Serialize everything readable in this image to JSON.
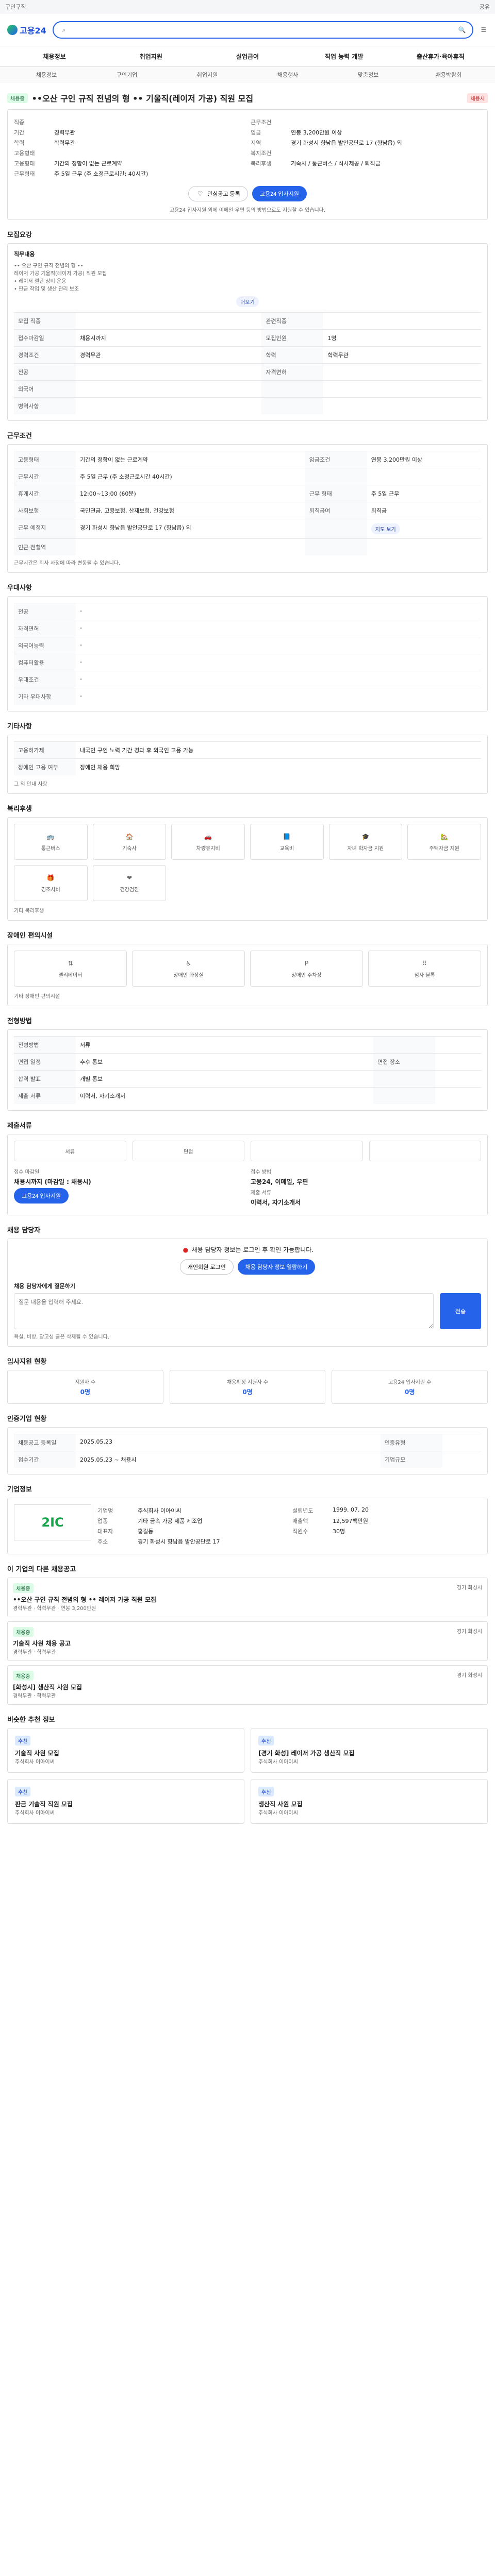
{
  "top": {
    "text": "구인구직",
    "right": "공유"
  },
  "header": {
    "logo": "고용24",
    "search_placeholder": "",
    "search_value": ""
  },
  "gnb": [
    "채용정보",
    "취업지원",
    "실업급여",
    "직업 능력 개발",
    "출산휴가·육아휴직"
  ],
  "subnav": [
    "채용정보",
    "구인기업",
    "취업지원",
    "채용행사",
    "맞춤정보",
    "채용박람회"
  ],
  "job": {
    "badge": "채용중",
    "title": "••오산 구인 규직 전념의 형 •• 기울직(레이저 가공) 직원 모집",
    "status_tag": "채용시",
    "left": [
      {
        "k": "직종",
        "v": ""
      },
      {
        "k": "기간",
        "v": "경력무관"
      },
      {
        "k": "학력",
        "v": "학력무관"
      },
      {
        "k": "고용형태",
        "v": ""
      },
      {
        "k": "고용형태",
        "v": "기간의 정함이 없는 근로계약"
      },
      {
        "k": "근무형태",
        "v": "주 5일 근무 (주 소정근로시간: 40시간)"
      }
    ],
    "right": [
      {
        "k": "근무조건",
        "v": ""
      },
      {
        "k": "임금",
        "v": "연봉 3,200만원 이상"
      },
      {
        "k": "지역",
        "v": "경기 화성시 향남읍 발안공단로 17 (향남읍) 외"
      },
      {
        "k": "복지조건",
        "v": ""
      },
      {
        "k": "복리후생",
        "v": "기숙사 / 통근버스 / 식사제공 / 퇴직금"
      }
    ],
    "actions": {
      "like": "관심공고 등록",
      "apply": "고용24 입사지원"
    },
    "notice": "고용24 입사지원 외에 이메일·우편 등의 방법으로도 지원할 수 있습니다."
  },
  "sections": {
    "recruit": "모집요강",
    "conditions": "근무조건",
    "welfare_sec": "우대사항",
    "etc": "기타사항",
    "benefits": "복리후생",
    "disability": "장애인 편의시설",
    "process": "전형방법",
    "documents": "제출서류",
    "contact": "채용 담당자",
    "stats": "입사지원 현황",
    "company": "기업정보",
    "other": "이 기업의 다른 채용공고",
    "similar": "비슷한 추천 정보"
  },
  "recruit": {
    "header": "직무내용",
    "content_lines": [
      "•• 오산 구인 규직 전념의 형 ••",
      "레이저 가공 기울직(레이저 가공) 직원 모집",
      "• 레이저 절단 장비 운용",
      "• 판금 작업 및 생산 관리 보조"
    ],
    "rows": [
      {
        "k": "모집 직종",
        "v": "",
        "k2": "관련직종",
        "v2": ""
      },
      {
        "k": "접수마감일",
        "v": "채용시까지",
        "k2": "모집인원",
        "v2": "1명"
      },
      {
        "k": "경력조건",
        "v": "경력무관",
        "k2": "학력",
        "v2": "학력무관"
      },
      {
        "k": "전공",
        "v": "",
        "k2": "자격면허",
        "v2": ""
      },
      {
        "k": "외국어",
        "v": "",
        "k2": "",
        "v2": ""
      },
      {
        "k": "병역사항",
        "v": "",
        "k2": "",
        "v2": ""
      }
    ],
    "more": "더보기"
  },
  "conditions": {
    "rows": [
      {
        "k": "고용형태",
        "v": "기간의 정함이 없는 근로계약",
        "k2": "임금조건",
        "v2": "연봉 3,200만원 이상"
      },
      {
        "k": "근무시간",
        "v": "주 5일 근무 (주 소정근로시간 40시간)",
        "k2": "",
        "v2": ""
      },
      {
        "k": "휴게시간",
        "v": "12:00~13:00 (60분)",
        "k2": "근무 형태",
        "v2": "주 5일 근무"
      },
      {
        "k": "사회보험",
        "v": "국민연금, 고용보험, 산재보험, 건강보험",
        "k2": "퇴직급여",
        "v2": "퇴직금"
      },
      {
        "k": "근무 예정지",
        "v": "경기 화성시 향남읍 발안공단로 17 (향남읍) 외",
        "k2": "",
        "v2": "지도 보기"
      },
      {
        "k": "인근 전철역",
        "v": "",
        "k2": "",
        "v2": ""
      }
    ],
    "note": "근무시간은 회사 사정에 따라 변동될 수 있습니다."
  },
  "welfare_sec": {
    "rows": [
      {
        "k": "전공",
        "v": "-"
      },
      {
        "k": "자격면허",
        "v": "-"
      },
      {
        "k": "외국어능력",
        "v": "-"
      },
      {
        "k": "컴퓨터활용",
        "v": "-"
      },
      {
        "k": "우대조건",
        "v": "-"
      },
      {
        "k": "기타 우대사항",
        "v": "-"
      }
    ]
  },
  "etc": {
    "rows": [
      {
        "k": "고용허가제",
        "v": "내국인 구인 노력 기간 경과 후 외국인 고용 가능"
      },
      {
        "k": "장애인 고용 여부",
        "v": "장애인 채용 희망"
      }
    ],
    "more": "그 외 안내 사항"
  },
  "benefits": {
    "items": [
      "통근버스",
      "기숙사",
      "차량유지비",
      "교육비",
      "자녀 학자금 지원",
      "주택자금 지원",
      "경조사비",
      "건강검진"
    ],
    "note": "기타 복리후생"
  },
  "disability": {
    "items": [
      "엘리베이터",
      "장애인 화장실",
      "장애인 주차장",
      "점자 블록"
    ],
    "note": "기타 장애인 편의시설"
  },
  "process": {
    "rows": [
      {
        "k": "전형방법",
        "v": "서류",
        "k2": "",
        "v2": ""
      },
      {
        "k": "면접 일정",
        "v": "추후 통보",
        "k2": "면접 장소",
        "v2": ""
      },
      {
        "k": "합격 발표",
        "v": "개별 통보",
        "k2": "",
        "v2": ""
      },
      {
        "k": "제출 서류",
        "v": "이력서, 자기소개서",
        "k2": "",
        "v2": ""
      }
    ]
  },
  "documents": {
    "steps": [
      "서류",
      "면접",
      "",
      ""
    ]
  },
  "apply_box": {
    "left_title": "접수 마감일",
    "left_value": "채용시까지 (마감일 : 채용시)",
    "left_btn": "고용24 입사지원",
    "right_title": "접수 방법",
    "right_value": "고용24, 이메일, 우편",
    "right2_title": "제출 서류",
    "right2_value": "이력서, 자기소개서"
  },
  "contact": {
    "alert": "채용 담당자 정보는 로그인 후 확인 가능합니다.",
    "btn1": "개인회원 로그인",
    "btn2": "채용 담당자 정보 열람하기",
    "inquiry_title": "채용 담당자에게 질문하기",
    "inquiry_placeholder": "질문 내용을 입력해 주세요.",
    "inquiry_btn": "전송",
    "footnote": "욕설, 비방, 광고성 글은 삭제될 수 있습니다."
  },
  "stats": {
    "title": "입사지원 현황",
    "items": [
      {
        "label": "지원자 수",
        "value": "0명"
      },
      {
        "label": "채용확정 지원자 수",
        "value": "0명"
      },
      {
        "label": "고용24 입사지원 수",
        "value": "0명"
      }
    ]
  },
  "history": {
    "title": "인증기업 현황",
    "rows": [
      {
        "k": "채용공고 등록일",
        "v": "2025.05.23",
        "k2": "인증유형",
        "v2": ""
      },
      {
        "k": "접수기간",
        "v": "2025.05.23 ~ 채용시",
        "k2": "기업규모",
        "v2": ""
      }
    ]
  },
  "company": {
    "logo_text": "2IC",
    "name": "주식회사 이아이씨",
    "rows": [
      {
        "k": "기업명",
        "v": "주식회사 이아이씨"
      },
      {
        "k": "업종",
        "v": "기타 금속 가공 제품 제조업"
      },
      {
        "k": "대표자",
        "v": "홍길동"
      },
      {
        "k": "주소",
        "v": "경기 화성시 향남읍 발안공단로 17"
      }
    ],
    "rows2": [
      {
        "k": "설립년도",
        "v": "1999. 07. 20"
      },
      {
        "k": "매출액",
        "v": "12,597백만원"
      },
      {
        "k": "직원수",
        "v": "30명"
      }
    ]
  },
  "other_jobs": [
    {
      "title": "••오산 구인 규직 전념의 형 •• 레이저 가공 직원 모집",
      "tag": "채용중",
      "meta": "경력무관 · 학력무관 · 연봉 3,200만원",
      "loc": "경기 화성시"
    },
    {
      "title": "기술직 사원 채용 공고",
      "tag": "채용중",
      "meta": "경력무관 · 학력무관",
      "loc": "경기 화성시"
    },
    {
      "title": "[화성시] 생산직 사원 모집",
      "tag": "채용중",
      "meta": "경력무관 · 학력무관",
      "loc": "경기 화성시"
    }
  ],
  "similar": [
    {
      "badge": "추천",
      "title": "기술직 사원 모집",
      "company": "주식회사 이아이씨"
    },
    {
      "badge": "추천",
      "title": "[경기 화성] 레이저 가공 생산직 모집",
      "company": "주식회사 이아이씨"
    },
    {
      "badge": "추천",
      "title": "판금 기술직 직원 모집",
      "company": "주식회사 이아이씨"
    },
    {
      "badge": "추천",
      "title": "생산직 사원 모집",
      "company": "주식회사 이아이씨"
    }
  ]
}
